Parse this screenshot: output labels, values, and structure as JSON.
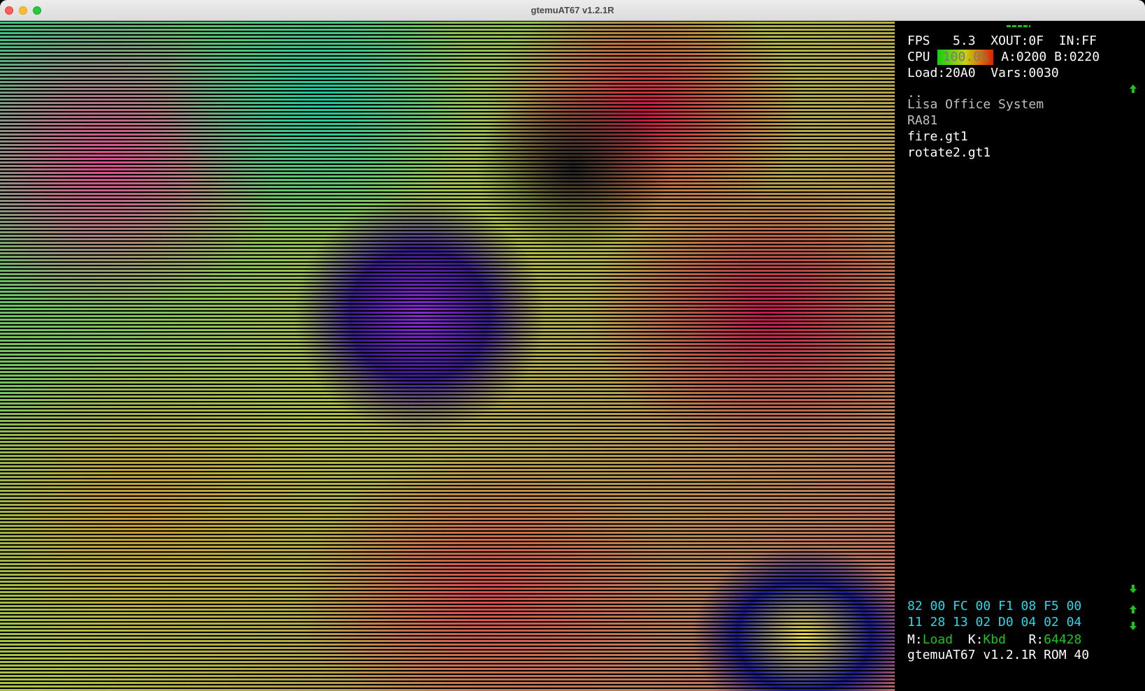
{
  "window": {
    "title": "gtemuAT67 v1.2.1R"
  },
  "stats": {
    "fps_label": "FPS",
    "fps_value": "5.3",
    "xout": "XOUT:0F",
    "in": "IN:FF",
    "cpu_label": "CPU",
    "cpu_value": "100.0%",
    "reg_a": "A:0200",
    "reg_b": "B:0220",
    "load": "Load:20A0",
    "vars": "Vars:0030"
  },
  "browser": {
    "items": [
      "..",
      "Lisa Office System",
      "RA81",
      "fire.gt1",
      "rotate2.gt1"
    ]
  },
  "hex": {
    "row1": "82 00 FC 00 F1 08 F5 00",
    "row2": "11 28 13 02 D0 04 02 04"
  },
  "status": {
    "mode_label": "M:",
    "mode_value": "Load",
    "key_label": "K:",
    "key_value": "Kbd",
    "rom_label": "R:",
    "rom_value": "64428",
    "footer": "gtemuAT67 v1.2.1R ROM 40"
  },
  "colors": {
    "accent_green": "#18c818",
    "hex_cyan": "#28d8e8",
    "menu_grey": "#bfbfbf"
  },
  "icons": [
    "close-button",
    "minimize-button",
    "maximize-button",
    "scroll-up-icon",
    "scroll-down-icon"
  ]
}
